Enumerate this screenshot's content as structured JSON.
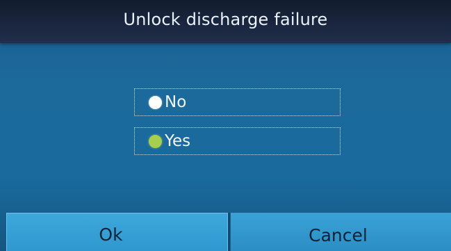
{
  "dialog": {
    "title": "Unlock discharge failure"
  },
  "options": [
    {
      "label": "No",
      "selected": false
    },
    {
      "label": "Yes",
      "selected": true
    }
  ],
  "buttons": {
    "ok_label": "Ok",
    "cancel_label": "Cancel"
  },
  "colors": {
    "title_bar": "#1b2740",
    "background": "#1c6a9c",
    "button": "#3aa2d6",
    "radio_selected": "#a6cf4e",
    "radio_unselected": "#ffffff"
  }
}
